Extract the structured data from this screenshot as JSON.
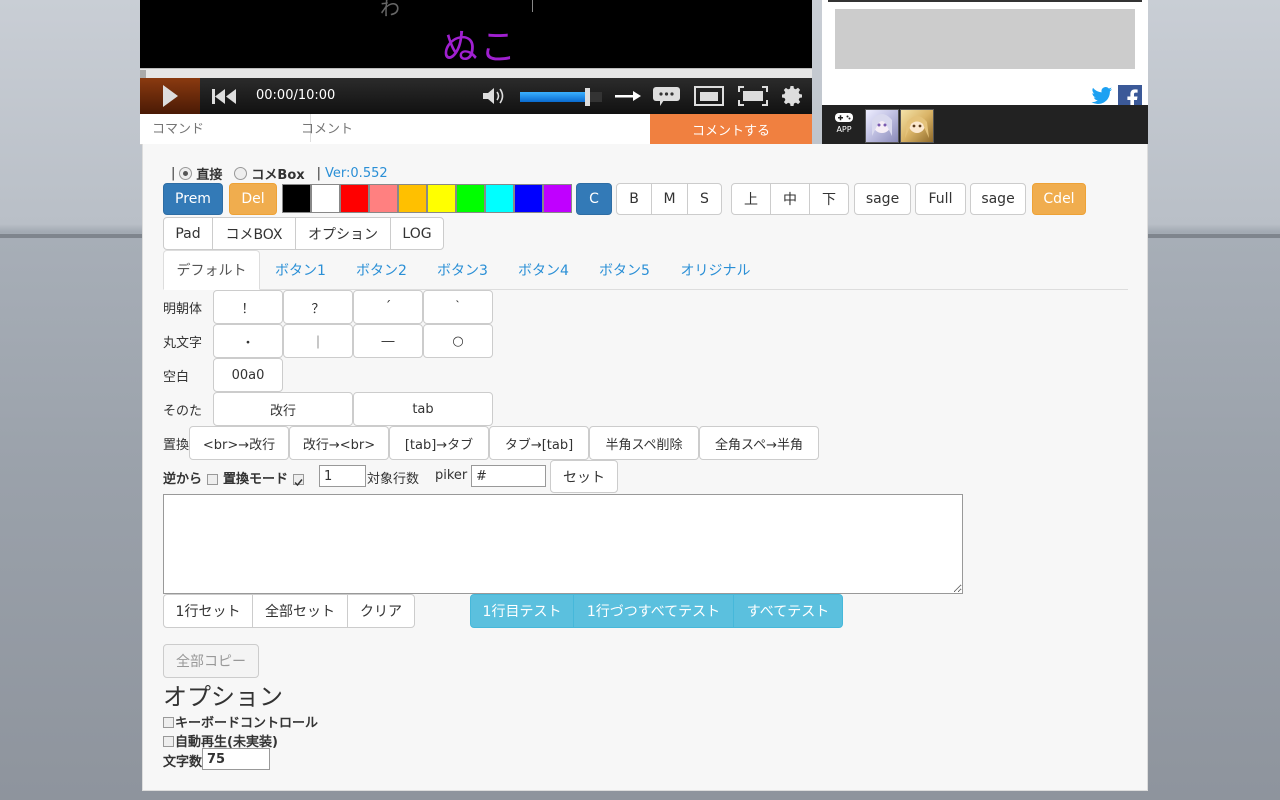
{
  "player": {
    "video_text": "ぬこ",
    "video_text_cut": "わ",
    "time": "00:00/10:00",
    "volume_level": 0.82,
    "command_placeholder": "コマンド",
    "comment_placeholder": "コメント",
    "submit_label": "コメントする",
    "icons": [
      "play-icon",
      "rewind-icon",
      "volume-icon",
      "arrow-right-icon",
      "comment-list-icon",
      "window-icon",
      "fullscreen-icon",
      "gear-icon"
    ]
  },
  "side": {
    "app_label": "APP",
    "icons": [
      "twitter-icon",
      "facebook-icon",
      "gamepad-icon"
    ]
  },
  "mode": {
    "sep": "|",
    "direct": "直接",
    "commebox": "コメBox",
    "version": "Ver:0.552"
  },
  "toolbar": {
    "prem": "Prem",
    "del": "Del",
    "colors": [
      "#000000",
      "#ffffff",
      "#ff0000",
      "#ff8080",
      "#ffc000",
      "#ffff00",
      "#00ff00",
      "#00ffff",
      "#0000ff",
      "#c000ff"
    ],
    "c": "C",
    "b": "B",
    "m": "M",
    "s": "S",
    "ue": "上",
    "naka": "中",
    "shita": "下",
    "sage1": "sage",
    "full": "Full",
    "sage2": "sage",
    "cdel": "Cdel"
  },
  "menu": {
    "pad": "Pad",
    "commebox": "コメBOX",
    "option": "オプション",
    "log": "LOG"
  },
  "tabs": [
    "デフォルト",
    "ボタン1",
    "ボタン2",
    "ボタン3",
    "ボタン4",
    "ボタン5",
    "オリジナル"
  ],
  "grid": {
    "row1_label": "明朝体",
    "row1": [
      "！",
      "？",
      "´",
      "｀"
    ],
    "row2_label": "丸文字",
    "row2": [
      "・",
      "｜",
      "―",
      "○"
    ],
    "row3_label": "空白",
    "row3": [
      "00a0"
    ],
    "row4_label": "そのた",
    "row4": [
      "改行",
      "tab"
    ],
    "row5_label": "置換",
    "row5": [
      "<br>→改行",
      "改行→<br>",
      "[tab]→タブ",
      "タブ→[tab]",
      "半角スペ削除",
      "全角スペ→半角"
    ]
  },
  "options_row": {
    "reverse": "逆から",
    "replace_mode": "置換モード",
    "lines_value": "1",
    "lines_label": "対象行数",
    "piker_label": "piker",
    "piker_value": "#",
    "set": "セット"
  },
  "actions": {
    "set_one": "1行セット",
    "set_all": "全部セット",
    "clear": "クリア",
    "test_one": "1行目テスト",
    "test_each": "1行づつすべてテスト",
    "test_all": "すべてテスト",
    "copy_all": "全部コピー"
  },
  "option_section": {
    "title": "オプション",
    "keyboard": "キーボードコントロール",
    "autoplay": "自動再生(未実装)",
    "charcount_label": "文字数",
    "charcount_value": "75"
  }
}
